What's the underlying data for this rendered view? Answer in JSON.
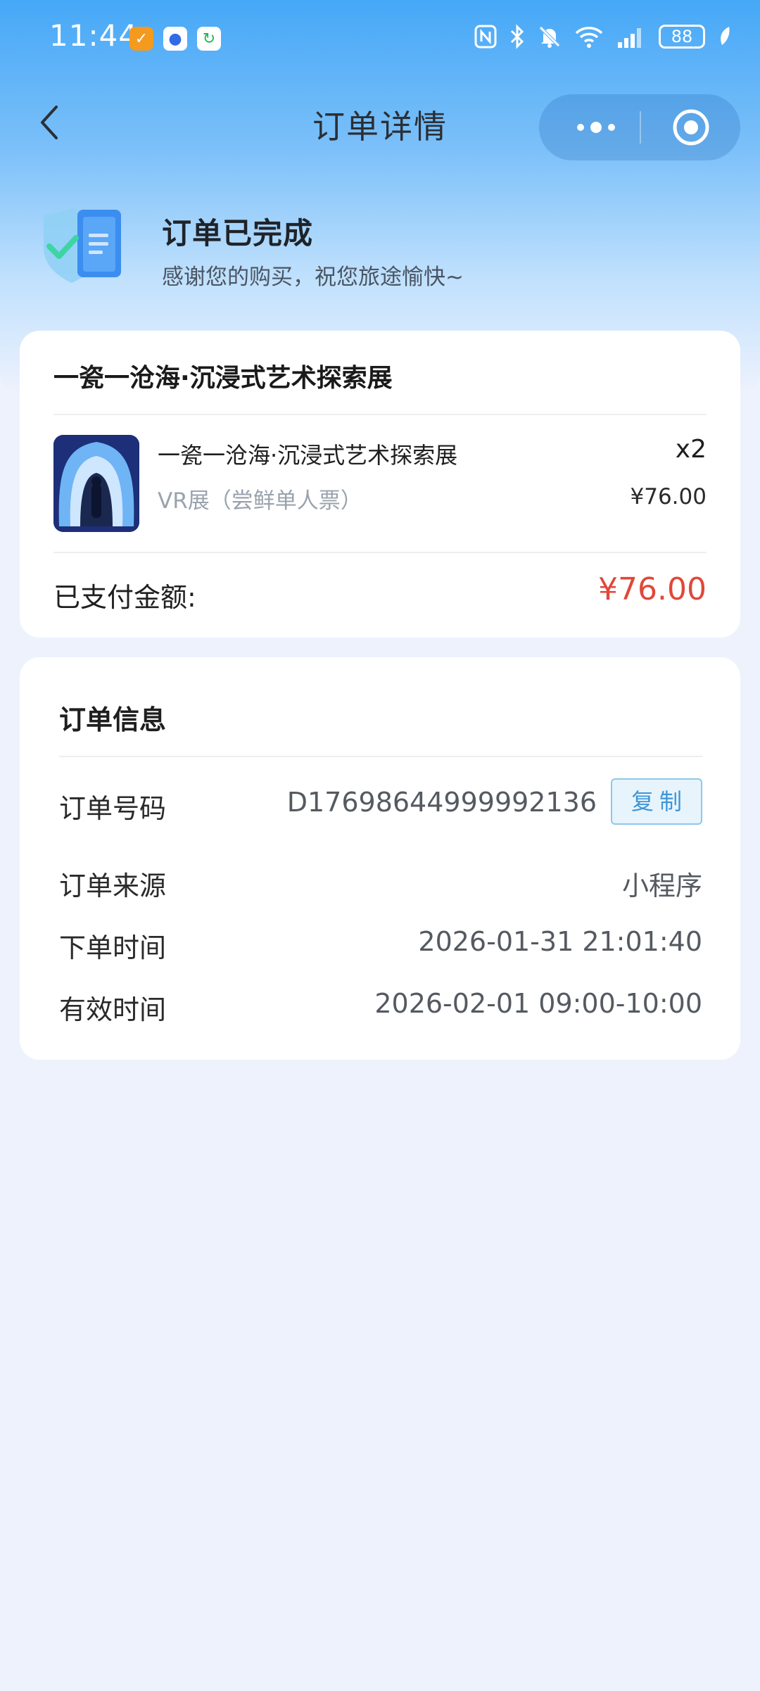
{
  "status_bar": {
    "time": "11:44",
    "battery": "88",
    "notification_icons": [
      "app-notification-icon",
      "baidu-paw-icon",
      "recycle-app-icon"
    ],
    "system_icons": [
      "nfc-icon",
      "bluetooth-icon",
      "mute-bell-icon",
      "wifi-icon",
      "signal-icon",
      "battery-icon",
      "leaf-charging-icon"
    ]
  },
  "nav": {
    "title": "订单详情"
  },
  "order_status": {
    "title": "订单已完成",
    "subtitle": "感谢您的购买，祝您旅途愉快~"
  },
  "product": {
    "title": "一瓷一沧海·沉浸式艺术探索展",
    "item": {
      "name": "一瓷一沧海·沉浸式艺术探索展",
      "variant": "VR展（尝鲜单人票）",
      "quantity": "x2",
      "price": "¥76.00"
    },
    "paid_label": "已支付金额:",
    "paid_amount": "¥76.00"
  },
  "order_info": {
    "title": "订单信息",
    "rows": [
      {
        "label": "订单号码",
        "value": "D17698644999992136"
      },
      {
        "label": "订单来源",
        "value": "小程序"
      },
      {
        "label": "下单时间",
        "value": "2026-01-31 21:01:40"
      },
      {
        "label": "有效时间",
        "value": "2026-02-01 09:00-10:00"
      }
    ],
    "copy_label": "复制"
  },
  "colors": {
    "accent_blue": "#46a8f7",
    "price_red": "#e0483a",
    "page_bg": "#eef2fd"
  }
}
